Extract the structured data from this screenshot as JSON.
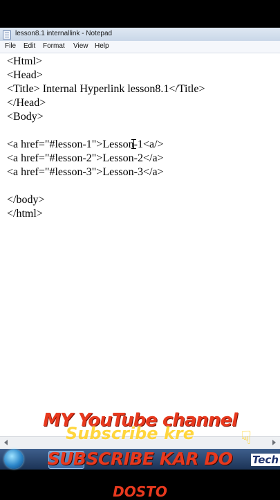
{
  "window": {
    "title": "lesson8.1 internallink - Notepad",
    "icon": "notepad-icon"
  },
  "menu": {
    "items": [
      "File",
      "Edit",
      "Format",
      "View",
      "Help"
    ]
  },
  "editor": {
    "text": "<Html>\n<Head>\n<Title> Internal Hyperlink lesson8.1</Title>\n</Head>\n<Body>\n\n<a href=\"#lesson-1\">Lesson-1<a/>\n<a href=\"#lesson-2\">Lesson-2</a>\n<a href=\"#lesson-3\">Lesson-3</a>\n\n</body>\n</html>"
  },
  "taskbar": {
    "tray_text": "Tech"
  },
  "overlay": {
    "line1": "MY YouTube channel",
    "line2": "Subscribe kre",
    "line3": "SUBSCRIBE KAR DO",
    "line4": "DOSTO"
  },
  "colors": {
    "overlay_red": "#e8391e",
    "overlay_yellow": "#ffd22a",
    "taskbar": "#1c3355"
  }
}
